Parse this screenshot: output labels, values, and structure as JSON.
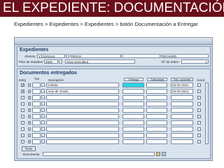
{
  "slide": {
    "title": "EL EXPEDIENTE: DOCUMENTACIÓN",
    "breadcrumb": "Expedientes > Expedientes > Expedientes > botón Documentación a Entregar"
  },
  "expedientes": {
    "title": "Expedientes",
    "alumno_label": "Alumno",
    "alumno_id": "Y721811111",
    "apellido1": "ROCU",
    "nombre": "RICHARD",
    "plan_label": "Plan de estudios",
    "plan_code": "2846",
    "plan_name": "Área Agricultura",
    "orden_label": "Nº de orden",
    "orden_value": "1"
  },
  "documentos": {
    "title": "Documentos entregados",
    "columns": {
      "entregado": "Entrg",
      "tipo": "Tpo",
      "descripcion": "Descripción",
      "entrega": "Entrega",
      "caducidad": "Caducidad",
      "doc_opcional": "Doc. opcional",
      "acred": "Acred."
    },
    "rows": [
      {
        "checked": "✔",
        "descripcion": "Cédula",
        "fecha": "03-02-2012",
        "acred": ""
      },
      {
        "checked": "✔",
        "descripcion": "Acta de Grado",
        "fecha": "03-02-2013",
        "acred": ""
      },
      {
        "checked": "",
        "descripcion": "",
        "fecha": "",
        "acred": ""
      },
      {
        "checked": "",
        "descripcion": "",
        "fecha": "",
        "acred": ""
      },
      {
        "checked": "",
        "descripcion": "",
        "fecha": "",
        "acred": ""
      },
      {
        "checked": "",
        "descripcion": "",
        "fecha": "",
        "acred": ""
      },
      {
        "checked": "",
        "descripcion": "",
        "fecha": "",
        "acred": ""
      },
      {
        "checked": "",
        "descripcion": "",
        "fecha": "",
        "acred": ""
      },
      {
        "checked": "",
        "descripcion": "",
        "fecha": "",
        "acred": ""
      },
      {
        "checked": "",
        "descripcion": "",
        "fecha": "",
        "acred": ""
      }
    ],
    "texto_button": "Texto",
    "documento_label": "Documento",
    "documento_value": ""
  },
  "colors": {
    "title_bar": "#6b0f1a",
    "highlight": "#2ad3e6",
    "panel": "#d9e3ee"
  },
  "icons": [
    "list-icon",
    "edit-icon",
    "help-icon",
    "scroll-up-icon",
    "scroll-down-icon"
  ]
}
